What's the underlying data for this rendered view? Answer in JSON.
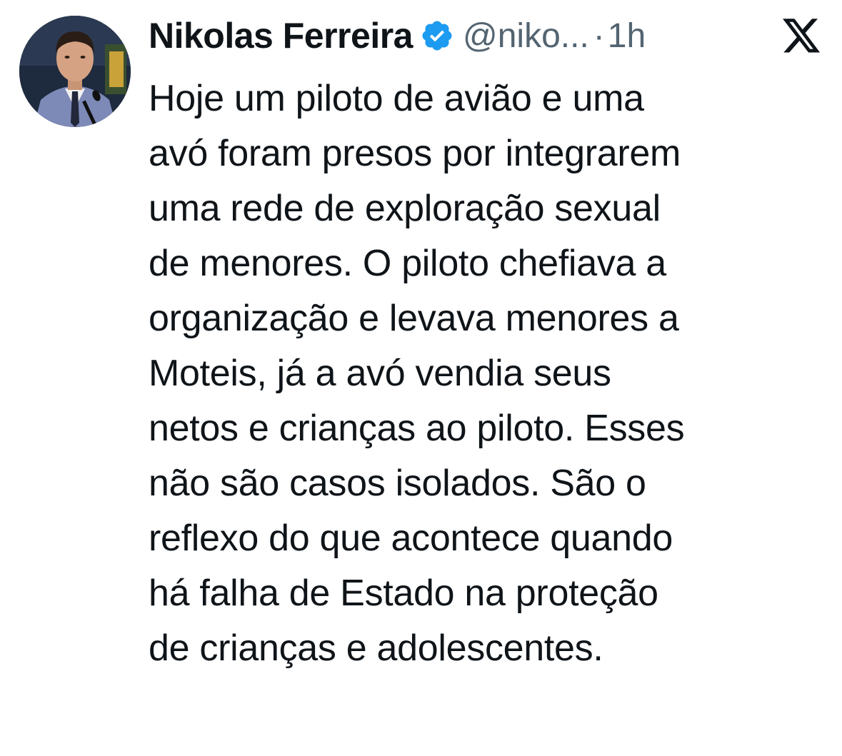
{
  "tweet": {
    "author": {
      "display_name": "Nikolas Ferreira",
      "handle": "@niko...",
      "verified": true,
      "avatar_icon": "profile-photo"
    },
    "separator": "·",
    "timestamp": "1h",
    "platform_icon": "x-logo-icon",
    "text_lines": [
      "Hoje um piloto de avião e uma",
      "avó foram presos por integrarem",
      "uma rede de exploração sexual",
      "de menores. O piloto chefiava a",
      "organização e levava menores a",
      "Moteis, já a avó vendia seus",
      "netos e crianças ao piloto. Esses",
      "não são casos isolados. São o",
      "reflexo do que acontece quando",
      "há falha de Estado na proteção",
      "de crianças e adolescentes."
    ]
  },
  "colors": {
    "text_primary": "#0f1419",
    "text_secondary": "#536471",
    "verified_blue": "#1d9bf0",
    "background": "#ffffff"
  }
}
